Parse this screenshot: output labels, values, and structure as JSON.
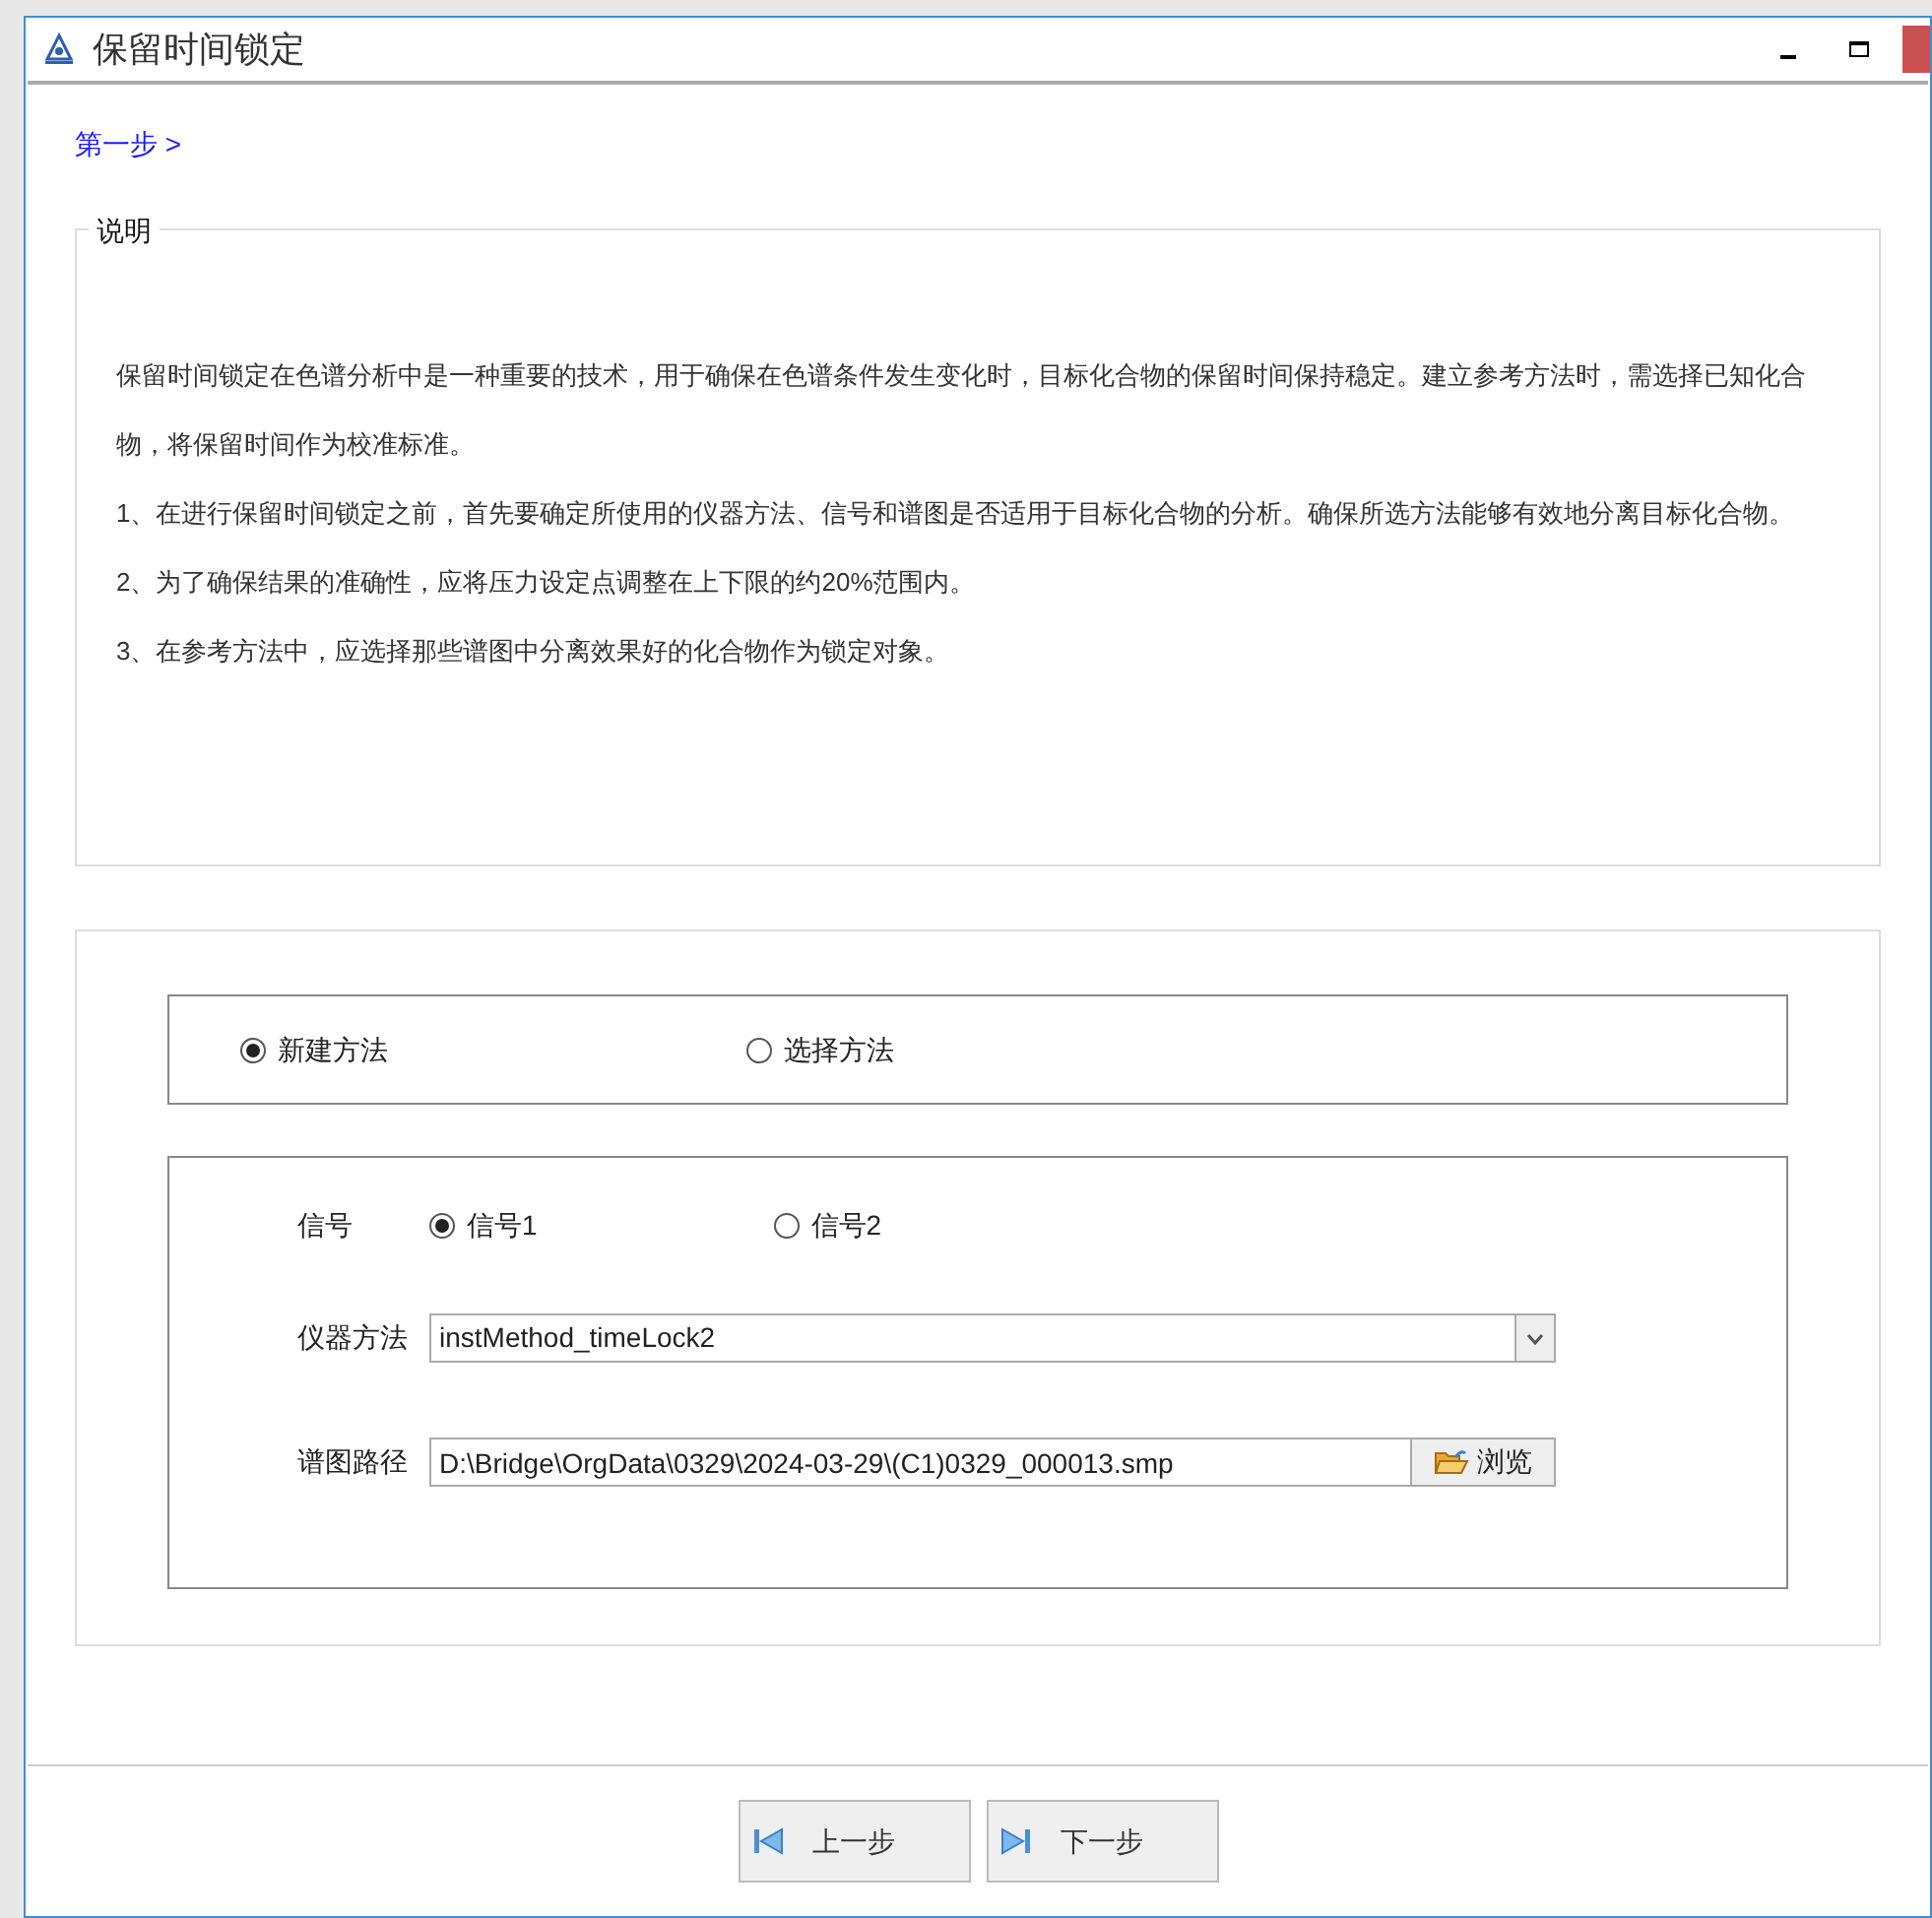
{
  "window": {
    "title": "保留时间锁定"
  },
  "breadcrumb": "第一步 >",
  "description": {
    "legend": "说明",
    "paragraphs": [
      "保留时间锁定在色谱分析中是一种重要的技术，用于确保在色谱条件发生变化时，目标化合物的保留时间保持稳定。建立参考方法时，需选择已知化合物，将保留时间作为校准标准。",
      "1、在进行保留时间锁定之前，首先要确定所使用的仪器方法、信号和谱图是否适用于目标化合物的分析。确保所选方法能够有效地分离目标化合物。",
      "2、为了确保结果的准确性，应将压力设定点调整在上下限的约20%范围内。",
      "3、在参考方法中，应选择那些谱图中分离效果好的化合物作为锁定对象。"
    ]
  },
  "method_options": [
    {
      "label": "新建方法",
      "selected": true
    },
    {
      "label": "选择方法",
      "selected": false
    }
  ],
  "signal": {
    "label": "信号",
    "options": [
      {
        "label": "信号1",
        "selected": true
      },
      {
        "label": "信号2",
        "selected": false
      }
    ]
  },
  "instrument_method": {
    "label": "仪器方法",
    "value": "instMethod_timeLock2"
  },
  "chromatogram_path": {
    "label": "谱图路径",
    "value": "D:\\Bridge\\OrgData\\0329\\2024-03-29\\(C1)0329_000013.smp",
    "browse": "浏览"
  },
  "buttons": [
    {
      "label": "上一步",
      "kind": "prev"
    },
    {
      "label": "下一步",
      "kind": "next"
    }
  ]
}
